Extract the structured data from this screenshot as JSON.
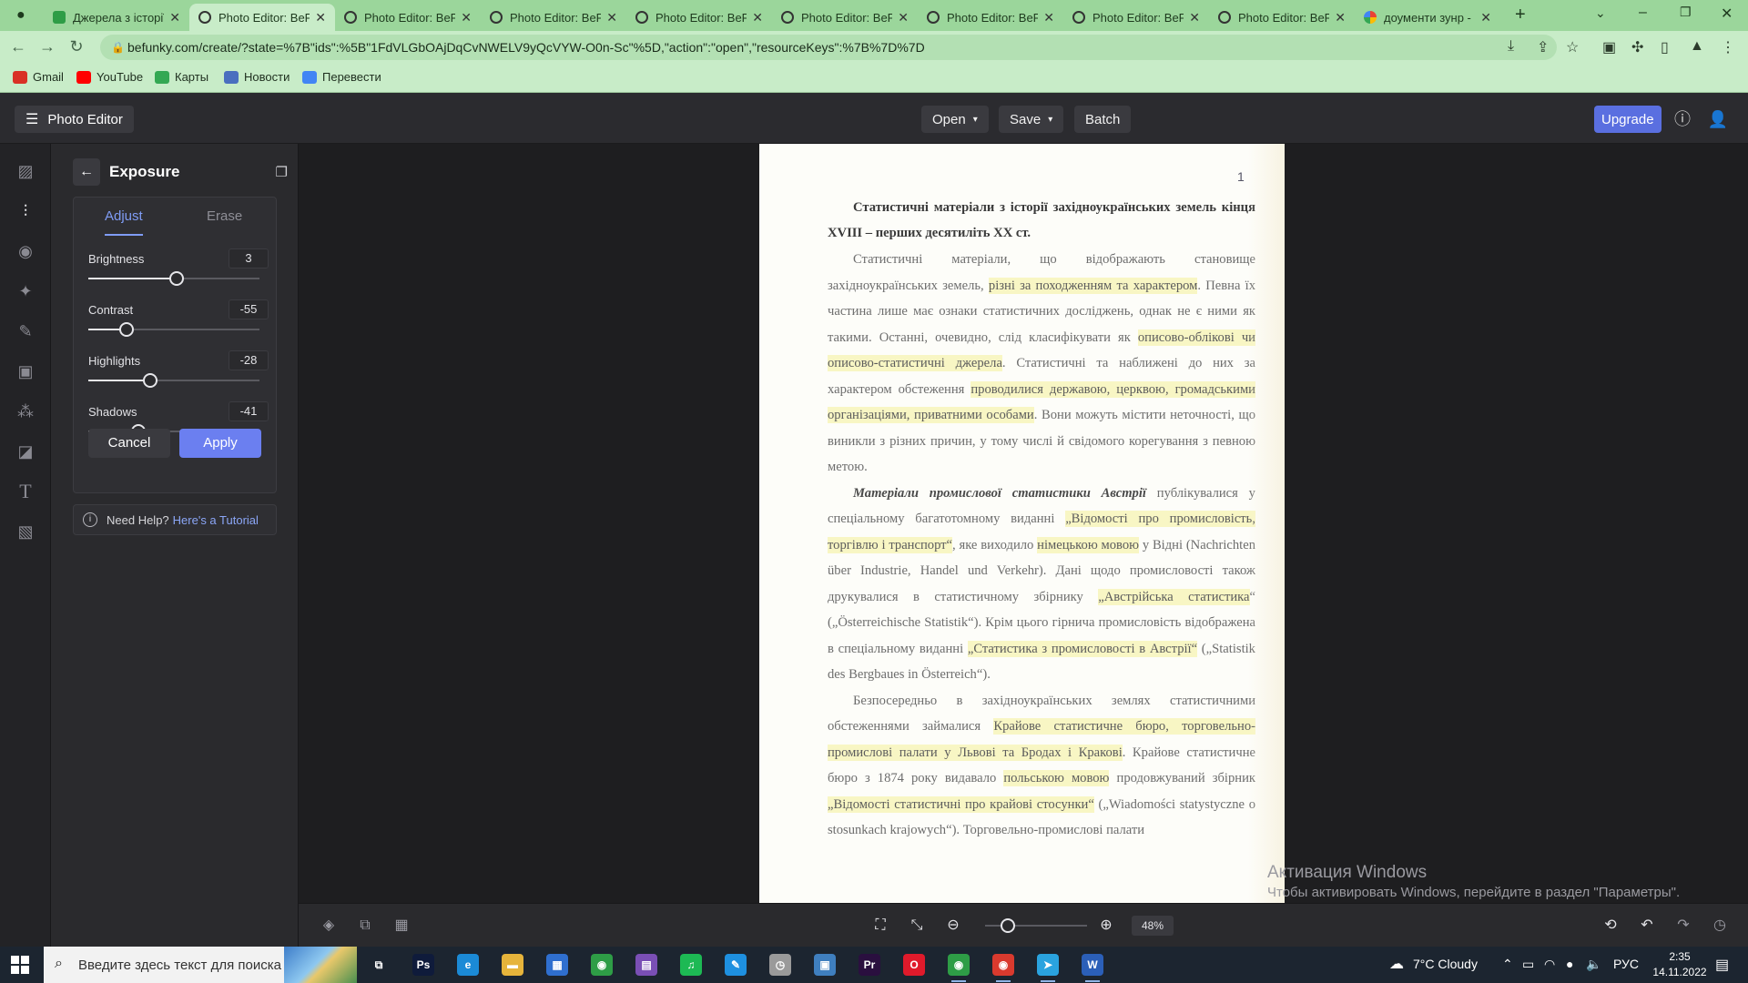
{
  "browser": {
    "tabs": [
      {
        "title": "Джерела з історії",
        "icon": "green"
      },
      {
        "title": "Photo Editor: BeFu",
        "icon": "befunky"
      },
      {
        "title": "Photo Editor: BeFu",
        "icon": "befunky"
      },
      {
        "title": "Photo Editor: BeFu",
        "icon": "befunky"
      },
      {
        "title": "Photo Editor: BeFu",
        "icon": "befunky"
      },
      {
        "title": "Photo Editor: BeFu",
        "icon": "befunky"
      },
      {
        "title": "Photo Editor: BeFu",
        "icon": "befunky"
      },
      {
        "title": "Photo Editor: BeFu",
        "icon": "befunky"
      },
      {
        "title": "Photo Editor: BeFu",
        "icon": "befunky"
      },
      {
        "title": "доументи зунр -",
        "icon": "google"
      }
    ],
    "active_tab_index": 1,
    "new_tab_label": "+",
    "url": "befunky.com/create/?state=%7B\"ids\":%5B\"1FdVLGbOAjDqCvNWELV9yQcVYW-O0n-Sc\"%5D,\"action\":\"open\",\"resourceKeys\":%7B%7D%7D",
    "bookmarks": [
      {
        "label": "Gmail",
        "color": "#d93025"
      },
      {
        "label": "YouTube",
        "color": "#ff0000"
      },
      {
        "label": "Карты",
        "color": "#34a853"
      },
      {
        "label": "Новости",
        "color": "#4a6fbf"
      },
      {
        "label": "Перевести",
        "color": "#4285f4"
      }
    ],
    "theme_color": "#9bd69b"
  },
  "app": {
    "menu_label": "Photo Editor",
    "header_buttons": {
      "open": "Open",
      "save": "Save",
      "batch": "Batch"
    },
    "upgrade_label": "Upgrade",
    "accent_color": "#6b7ff0"
  },
  "panel": {
    "title": "Exposure",
    "tabs": {
      "adjust": "Adjust",
      "erase": "Erase"
    },
    "sliders": [
      {
        "label": "Brightness",
        "value": 3,
        "min": -100,
        "max": 100
      },
      {
        "label": "Contrast",
        "value": -55,
        "min": -100,
        "max": 100
      },
      {
        "label": "Highlights",
        "value": -28,
        "min": -100,
        "max": 100
      },
      {
        "label": "Shadows",
        "value": -41,
        "min": -100,
        "max": 100
      }
    ],
    "cancel_label": "Cancel",
    "apply_label": "Apply",
    "help_text": "Need Help?",
    "help_link": "Here's a Tutorial"
  },
  "document": {
    "page_mark": "1",
    "heading": "Статистичні матеріали з історії західноукраїнських земель кінця XVIII – перших десятиліть XX ст.",
    "p1": [
      {
        "t": "Статистичні матеріали, що відображають становище західноукраїнських земель, "
      },
      {
        "t": "різні за походженням та характером",
        "hl": true
      },
      {
        "t": ". Певна їх частина лише має ознаки статистичних досліджень, однак не є ними як такими. Останні, очевидно, слід класифікувати як "
      },
      {
        "t": "описово-облікові чи описово-статистичні джерела",
        "hl": true
      },
      {
        "t": ". Статистичні та наближені до них за характером обстеження "
      },
      {
        "t": "проводилися державою, церквою, громадськими організаціями, приватними особами",
        "hl": true
      },
      {
        "t": ". Вони можуть містити неточності, що виникли з різних причин, у тому числі й свідомого корегування з певною метою."
      }
    ],
    "p2": [
      {
        "t": "Матеріали промислової статистики Австрії",
        "bi": true
      },
      {
        "t": " публікувалися у спеціальному багатотомному виданні "
      },
      {
        "t": "„Відомості про промисловість, торгівлю і транспорт“",
        "hl": true
      },
      {
        "t": ", яке виходило "
      },
      {
        "t": "німецькою мовою",
        "hl": true
      },
      {
        "t": " у Відні (Nachrichten über Industrie, Handel und Verkehr). Дані щодо промисловості також друкувалися в статистичному збірнику "
      },
      {
        "t": "„Австрійська статистика",
        "hl": true
      },
      {
        "t": "“ („Österreichische Statistik“). Крім цього гірнича промисловість відображена в спеціальному виданні "
      },
      {
        "t": "„Статистика з промисловості в Австрії“",
        "hl": true
      },
      {
        "t": " („Statistik des Bergbaues in Österreich“)."
      }
    ],
    "p3": [
      {
        "t": "Безпосередньо в західноукраїнських землях статистичними обстеженнями займалися "
      },
      {
        "t": "Крайове статистичне бюро, торговельно-промислові палати у Львові та Бродах і Кракові",
        "hl": true
      },
      {
        "t": ". Крайове статистичне бюро з 1874 року видавало "
      },
      {
        "t": "польською мовою",
        "hl": true
      },
      {
        "t": " продовжуваний збірник "
      },
      {
        "t": "„Відомості статистичні про крайові стосунки“",
        "hl": true
      },
      {
        "t": " („Wiadomości statystyczne o stosunkach krajowych“). Торговельно-промислові палати"
      }
    ]
  },
  "zoom": {
    "label": "48%",
    "value": 48,
    "min": 5,
    "max": 200
  },
  "watermark": {
    "title": "Активация Windows",
    "subtitle": "Чтобы активировать Windows, перейдите в раздел \"Параметры\"."
  },
  "taskbar": {
    "search_placeholder": "Введите здесь текст для поиска",
    "weather": "7°C  Cloudy",
    "language": "РУС",
    "time": "2:35",
    "date": "14.11.2022",
    "apps": [
      {
        "name": "task-view",
        "glyph": "⧉",
        "bg": "transparent"
      },
      {
        "name": "photoshop",
        "glyph": "Ps",
        "bg": "#0f1b3b"
      },
      {
        "name": "edge",
        "glyph": "e",
        "bg": "#1b8ad6"
      },
      {
        "name": "file-explorer",
        "glyph": "▬",
        "bg": "#e6b43b"
      },
      {
        "name": "store",
        "glyph": "▦",
        "bg": "#2f6fcf"
      },
      {
        "name": "chrome",
        "glyph": "◉",
        "bg": "#2e9d46"
      },
      {
        "name": "winrar",
        "glyph": "▤",
        "bg": "#7a4fb5"
      },
      {
        "name": "spotify",
        "glyph": "♫",
        "bg": "#1db954"
      },
      {
        "name": "pen-app",
        "glyph": "✎",
        "bg": "#1e90e0"
      },
      {
        "name": "clock-app",
        "glyph": "◷",
        "bg": "#9a9a9a"
      },
      {
        "name": "screenshot-app",
        "glyph": "▣",
        "bg": "#3f7fbf"
      },
      {
        "name": "premiere",
        "glyph": "Pr",
        "bg": "#2a0f3f"
      },
      {
        "name": "opera",
        "glyph": "O",
        "bg": "#e01a2b"
      },
      {
        "name": "chrome-2",
        "glyph": "◉",
        "bg": "#2e9d46"
      },
      {
        "name": "chrome-3",
        "glyph": "◉",
        "bg": "#d93a2e"
      },
      {
        "name": "telegram",
        "glyph": "➤",
        "bg": "#2aa3df"
      },
      {
        "name": "word",
        "glyph": "W",
        "bg": "#2b5fb8"
      }
    ]
  }
}
